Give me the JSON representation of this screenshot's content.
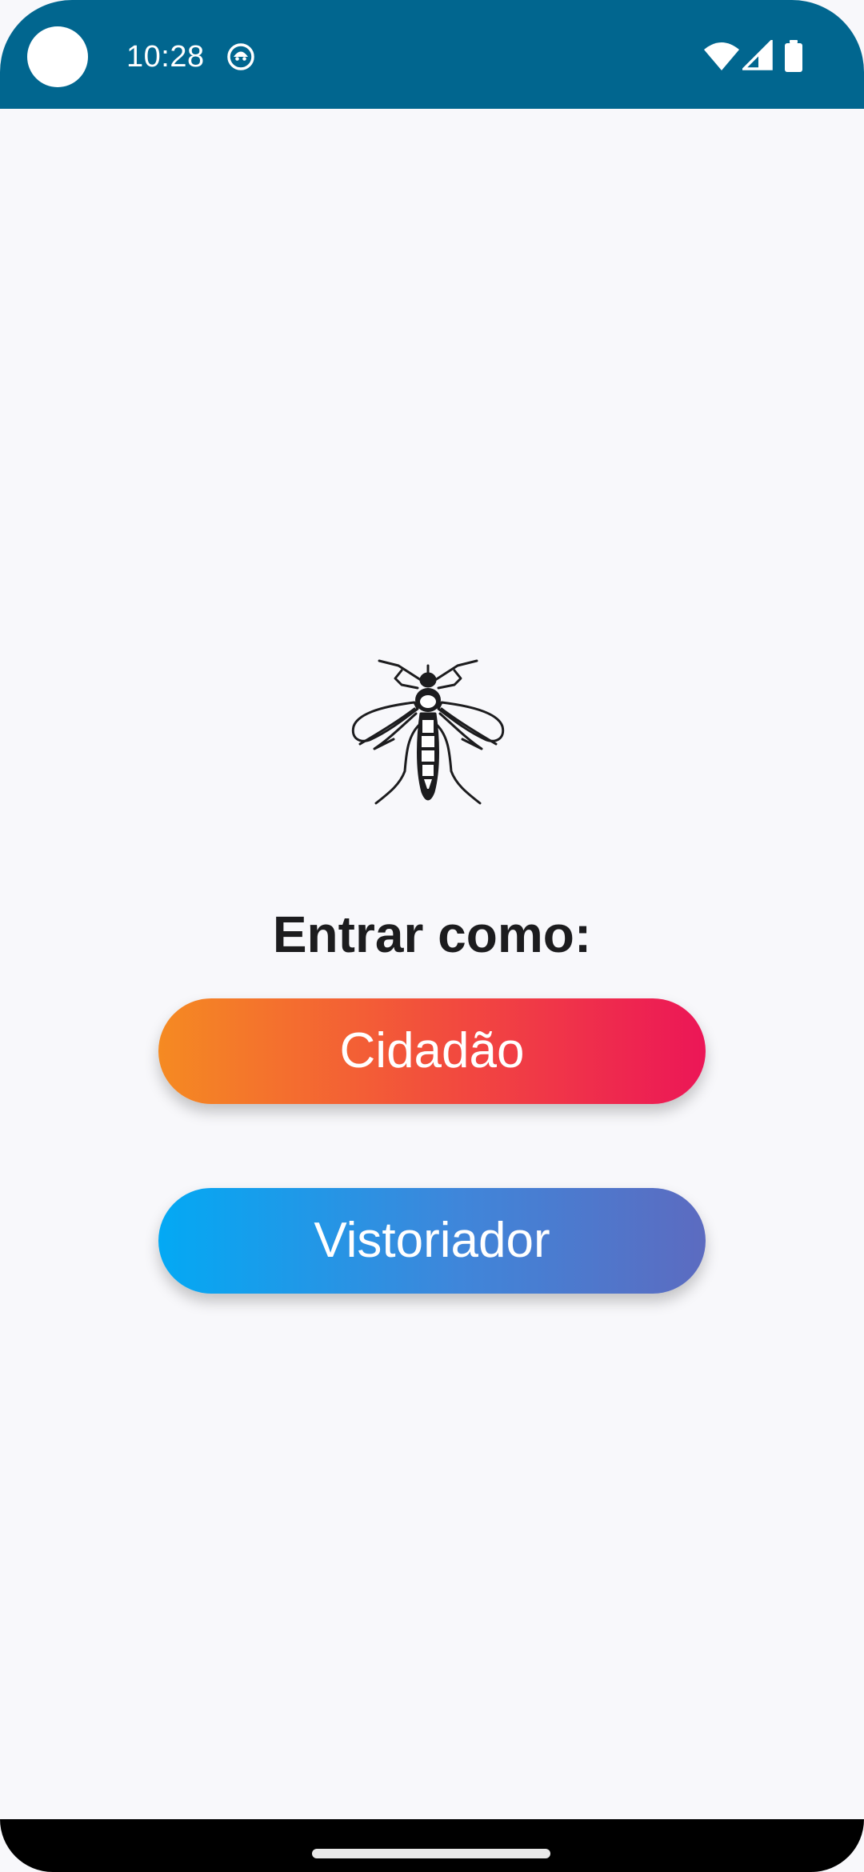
{
  "status_bar": {
    "time": "10:28",
    "background_color": "#01668f",
    "icons": [
      "camera-cutout",
      "notification-icon",
      "wifi-icon",
      "signal-icon",
      "battery-icon"
    ]
  },
  "main": {
    "logo_icon": "mosquito-icon",
    "prompt": "Entrar como:",
    "buttons": {
      "citizen_label": "Cidadão",
      "inspector_label": "Vistoriador"
    }
  },
  "colors": {
    "background": "#f8f8fb",
    "citizen_gradient": [
      "#f58a22",
      "#ec1657"
    ],
    "inspector_gradient": [
      "#03a9f4",
      "#5c6bc0"
    ]
  },
  "navigation": {
    "handle": "home-gesture-handle"
  }
}
